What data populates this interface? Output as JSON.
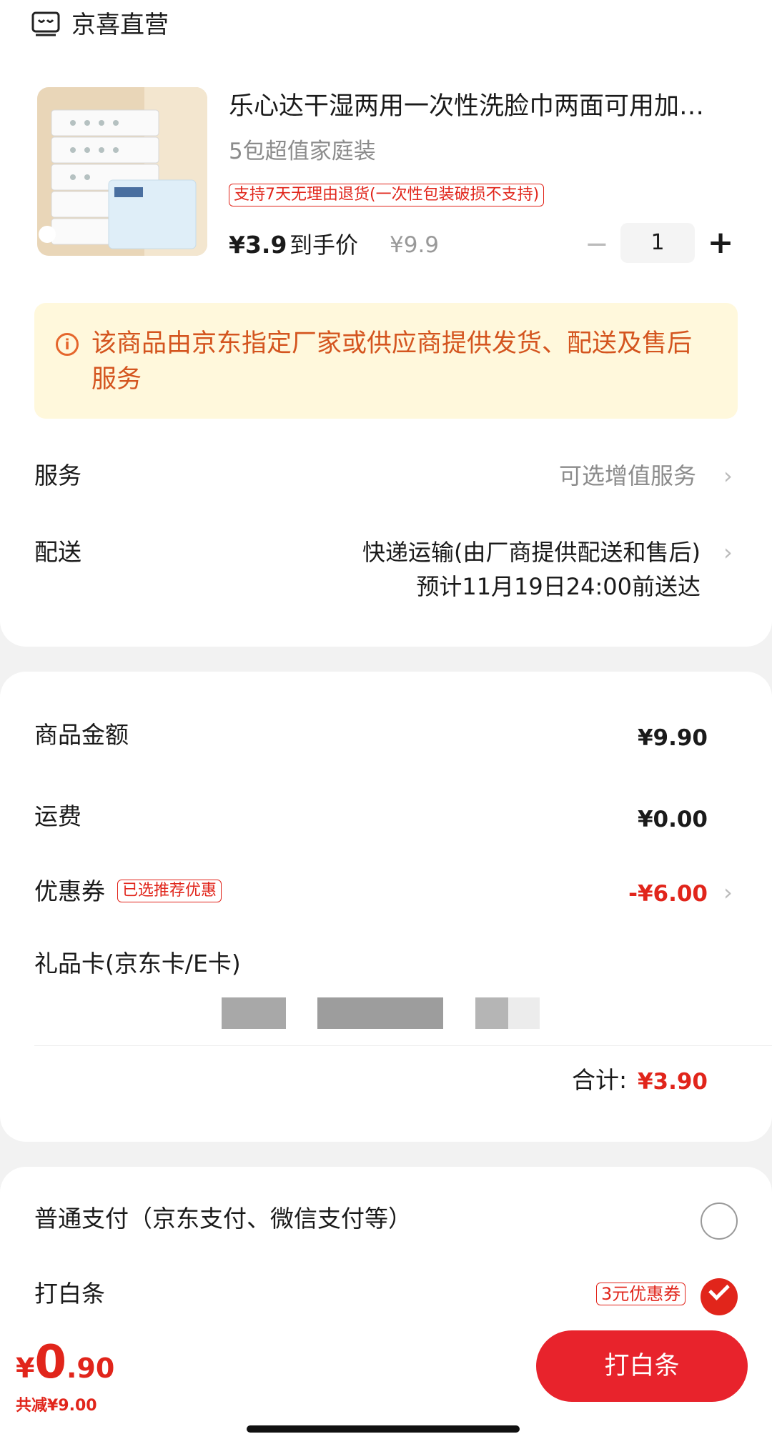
{
  "shop": {
    "name": "京喜直营",
    "icon": "store-icon"
  },
  "product": {
    "title": "乐心达干湿两用一次性洗脸巾两面可用加…",
    "spec": "5包超值家庭装",
    "policy_tag": "支持7天无理由退货(一次性包装破损不支持)",
    "price": "¥3.9",
    "price_label": "到手价",
    "original_price": "¥9.9",
    "quantity": "1",
    "minus": "−",
    "plus": "+"
  },
  "notice": {
    "icon_glyph": "i",
    "text": "该商品由京东指定厂家或供应商提供发货、配送及售后服务"
  },
  "service": {
    "label": "服务",
    "value": "可选增值服务"
  },
  "delivery": {
    "label": "配送",
    "value": "快递运输(由厂商提供配送和售后)",
    "eta": "预计11月19日24:00前送达"
  },
  "summary": {
    "goods_label": "商品金额",
    "goods_value": "¥9.90",
    "shipping_label": "运费",
    "shipping_value": "¥0.00",
    "coupon_label": "优惠券",
    "coupon_badge": "已选推荐优惠",
    "coupon_value": "-¥6.00",
    "giftcard_label": "礼品卡(京东卡/E卡)",
    "total_label": "合计:",
    "total_value": "¥3.90"
  },
  "payment": {
    "normal_label": "普通支付（京东支付、微信支付等）",
    "baitiao_label": "打白条",
    "baitiao_badge": "3元优惠券"
  },
  "footer": {
    "currency": "¥",
    "amount_int": "0",
    "amount_dec": ".90",
    "saved": "共减¥9.00",
    "pay_button": "打白条"
  },
  "chevron": "›",
  "colors": {
    "accent": "#e1251b",
    "notice_bg": "#fff8dc",
    "notice_text": "#d4551f"
  }
}
